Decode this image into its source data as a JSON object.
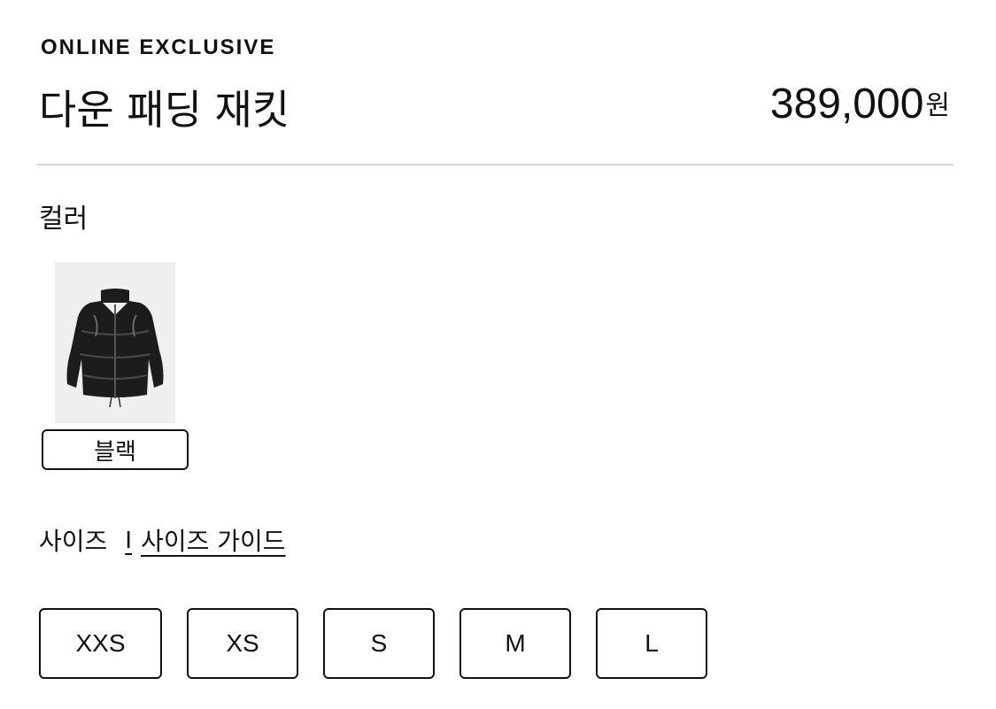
{
  "product": {
    "badge": "ONLINE EXCLUSIVE",
    "title": "다운 패딩 재킷",
    "price": "389,000",
    "currency": "원"
  },
  "color_section": {
    "label": "컬러",
    "swatches": [
      {
        "label": "블랙",
        "image": "black-puffer-jacket-thumbnail",
        "selected": true
      }
    ]
  },
  "size_section": {
    "label": "사이즈",
    "separator": "I",
    "guide_link": "사이즈 가이드",
    "options": [
      "XXS",
      "XS",
      "S",
      "M",
      "L"
    ]
  },
  "colors": {
    "text": "#111111",
    "divider": "#d6d6d6",
    "swatch_bg": "#efefef",
    "jacket": "#1c1c1c"
  }
}
